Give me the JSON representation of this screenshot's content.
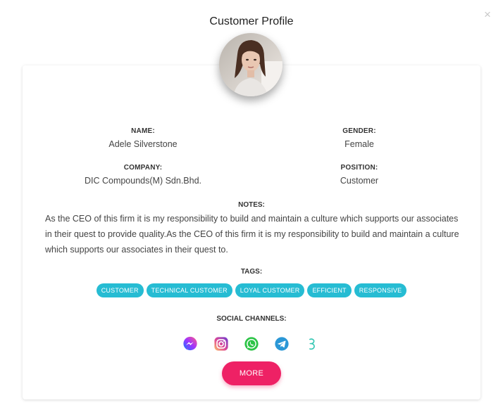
{
  "modal": {
    "title": "Customer Profile",
    "close_symbol": "×"
  },
  "profile": {
    "name_label": "NAME:",
    "name_value": "Adele Silverstone",
    "gender_label": "GENDER:",
    "gender_value": "Female",
    "company_label": "COMPANY:",
    "company_value": "DIC Compounds(M) Sdn.Bhd.",
    "position_label": "POSITION:",
    "position_value": "Customer",
    "notes_label": "NOTES:",
    "notes_value": "As the CEO of this firm it is my responsibility to build and maintain a culture which supports our associates in their quest to provide quality.As the CEO of this firm it is my responsibility to build and maintain a culture which supports our associates in their quest to."
  },
  "tags": {
    "label": "TAGS:",
    "items": [
      "CUSTOMER",
      "TECHNICAL CUSTOMER",
      "LOYAL CUSTOMER",
      "EFFICIENT",
      "RESPONSIVE"
    ],
    "color": "#26bcd3"
  },
  "social": {
    "label": "SOCIAL CHANNELS:",
    "icons": [
      "messenger-icon",
      "instagram-icon",
      "whatsapp-icon",
      "telegram-icon",
      "wechat-icon"
    ]
  },
  "actions": {
    "more_label": "MORE",
    "more_color": "#ee2165"
  }
}
